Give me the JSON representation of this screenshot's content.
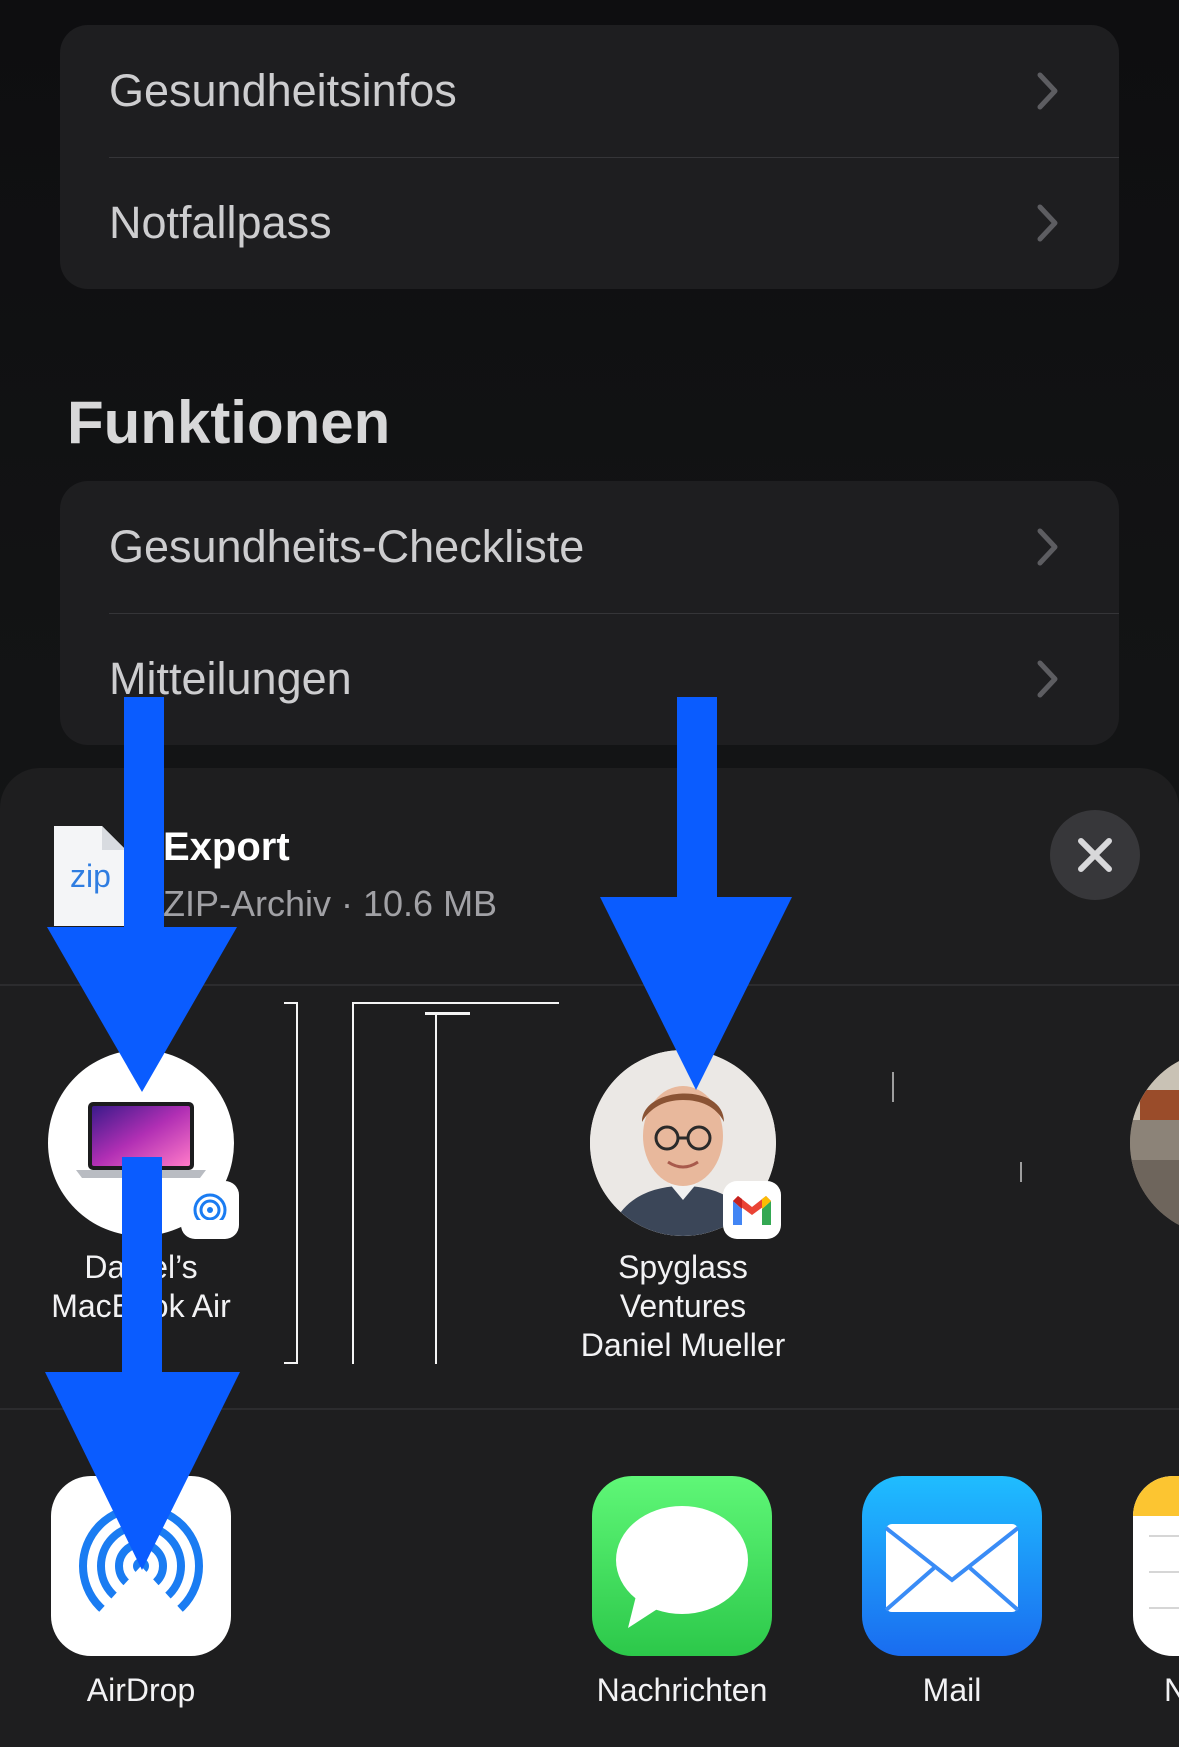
{
  "settings": {
    "top_group": [
      {
        "label": "Gesundheitsinfos"
      },
      {
        "label": "Notfallpass"
      }
    ],
    "section_title": "Funktionen",
    "functions_group": [
      {
        "label": "Gesundheits-Checkliste"
      },
      {
        "label": "Mitteilungen"
      }
    ]
  },
  "share_sheet": {
    "file_icon_text": "zip",
    "title": "Export",
    "subtitle": "ZIP-Archiv · 10.6 MB",
    "people": [
      {
        "line1": "Daniel’s",
        "line2": "MacBook Air",
        "line3": "",
        "badge": "airdrop-icon"
      },
      {
        "line1": "Spyglass",
        "line2": "Ventures",
        "line3": "Daniel Mueller",
        "badge": "gmail-icon"
      }
    ],
    "apps": [
      {
        "label": "AirDrop",
        "icon": "airdrop-icon"
      },
      {
        "label": "Nachrichten",
        "icon": "messages-icon"
      },
      {
        "label": "Mail",
        "icon": "mail-icon"
      },
      {
        "label": "N",
        "icon": "notes-icon"
      }
    ]
  },
  "colors": {
    "arrow": "#0a5cff",
    "messages_green": "#34c759",
    "mail_blue": "#1a8cff",
    "airdrop_blue": "#1a7cf2"
  }
}
